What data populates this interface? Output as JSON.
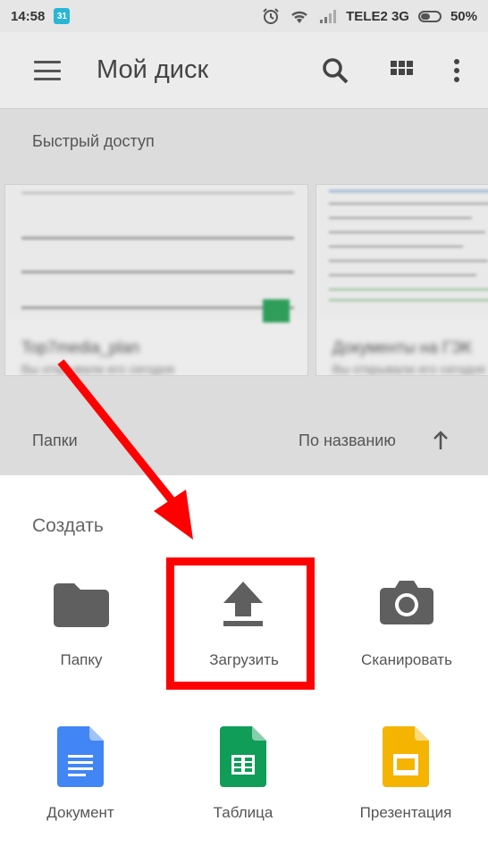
{
  "status_bar": {
    "time": "14:58",
    "calendar_badge": "31",
    "carrier": "TELE2 3G",
    "battery": "50%",
    "battery_level": 0.5
  },
  "app_bar": {
    "title": "Мой диск",
    "icons": [
      "menu-icon",
      "search-icon",
      "grid-view-icon",
      "more-vert-icon"
    ]
  },
  "quick_access": {
    "label": "Быстрый доступ",
    "cards": [
      {
        "title": "Top7media_plan",
        "subtitle": "Вы открывали его сегодня"
      },
      {
        "title": "Документы на ГЭК",
        "subtitle": "Вы открывали его сегодня"
      }
    ]
  },
  "folders": {
    "label": "Папки",
    "sort_label": "По названию"
  },
  "create_sheet": {
    "title": "Создать",
    "options": [
      {
        "label": "Папку",
        "icon": "folder-icon"
      },
      {
        "label": "Загрузить",
        "icon": "upload-icon"
      },
      {
        "label": "Сканировать",
        "icon": "camera-icon"
      },
      {
        "label": "Документ",
        "icon": "docs-icon"
      },
      {
        "label": "Таблица",
        "icon": "sheets-icon"
      },
      {
        "label": "Презентация",
        "icon": "slides-icon"
      }
    ]
  },
  "colors": {
    "annotation": "#ff0000",
    "docs": "#4285f4",
    "sheets": "#0f9d58",
    "slides": "#f4b400"
  }
}
